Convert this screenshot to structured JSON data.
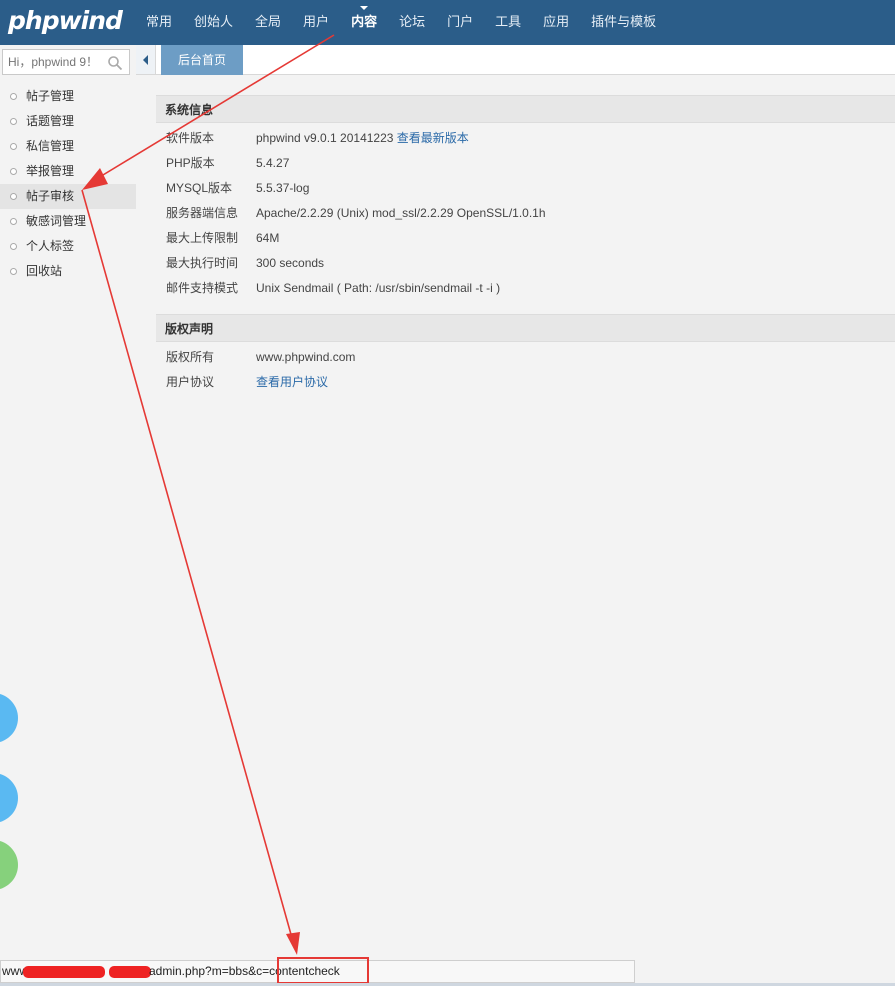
{
  "header": {
    "logo": "phpwind",
    "nav": [
      {
        "label": "常用"
      },
      {
        "label": "创始人"
      },
      {
        "label": "全局"
      },
      {
        "label": "用户"
      },
      {
        "label": "内容",
        "active": true
      },
      {
        "label": "论坛"
      },
      {
        "label": "门户"
      },
      {
        "label": "工具"
      },
      {
        "label": "应用"
      },
      {
        "label": "插件与模板"
      }
    ]
  },
  "sidebar": {
    "search_placeholder": "Hi，phpwind 9！",
    "items": [
      {
        "label": "帖子管理"
      },
      {
        "label": "话题管理"
      },
      {
        "label": "私信管理"
      },
      {
        "label": "举报管理"
      },
      {
        "label": "帖子审核",
        "selected": true
      },
      {
        "label": "敏感词管理"
      },
      {
        "label": "个人标签"
      },
      {
        "label": "回收站"
      }
    ]
  },
  "tabs": {
    "active_label": "后台首页"
  },
  "system_info": {
    "title": "系统信息",
    "rows": [
      {
        "key": "软件版本",
        "value": "phpwind v9.0.1 20141223",
        "link": "查看最新版本"
      },
      {
        "key": "PHP版本",
        "value": "5.4.27"
      },
      {
        "key": "MYSQL版本",
        "value": "5.5.37-log"
      },
      {
        "key": "服务器端信息",
        "value": "Apache/2.2.29 (Unix) mod_ssl/2.2.29 OpenSSL/1.0.1h"
      },
      {
        "key": "最大上传限制",
        "value": "64M"
      },
      {
        "key": "最大执行时间",
        "value": "300 seconds"
      },
      {
        "key": "邮件支持模式",
        "value": "Unix Sendmail ( Path: /usr/sbin/sendmail -t -i )"
      }
    ]
  },
  "copyright": {
    "title": "版权声明",
    "owner_key": "版权所有",
    "owner_value": "www.phpwind.com",
    "agreement_key": "用户协议",
    "agreement_link": "查看用户协议"
  },
  "statusbar": {
    "url_prefix": "www",
    "url_tail": "admin.php?m=bbs&c=contentcheck"
  },
  "colors": {
    "topbar": "#2b5d89",
    "tab_active": "#6d9dc5",
    "link": "#2b6aa8",
    "annotation": "#e53935"
  }
}
